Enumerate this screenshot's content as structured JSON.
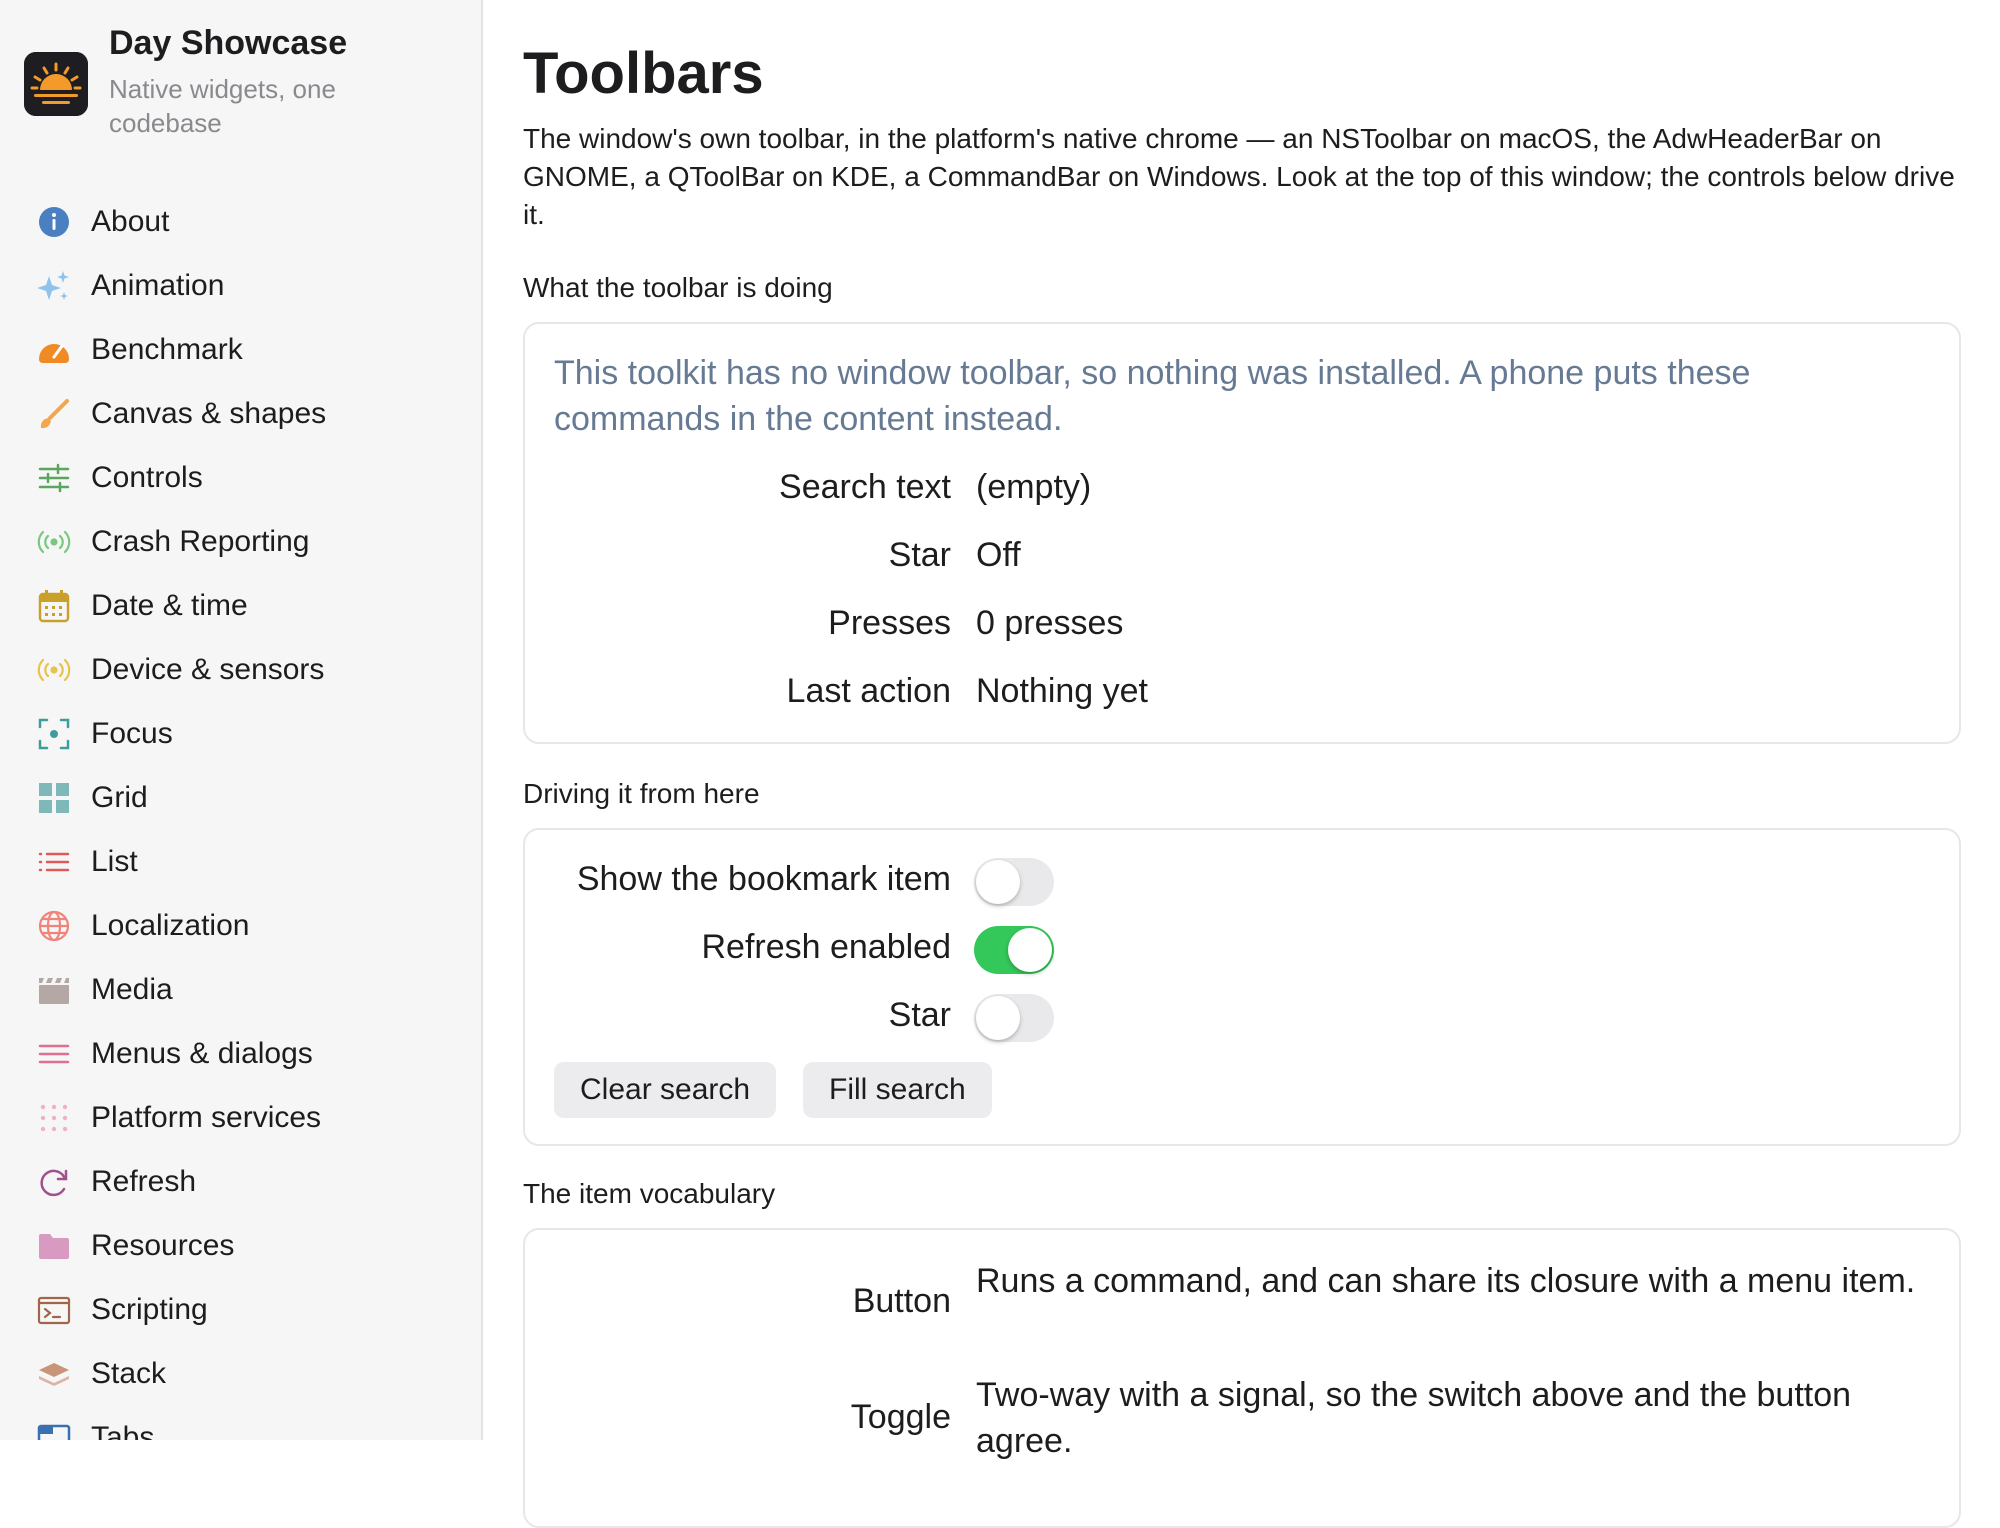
{
  "app": {
    "title": "Day Showcase",
    "subtitle": "Native widgets, one codebase"
  },
  "sidebar": {
    "items": [
      {
        "label": "About",
        "icon": "info-icon",
        "color": "#4a7fc1"
      },
      {
        "label": "Animation",
        "icon": "sparkles-icon",
        "color": "#8fc3ec"
      },
      {
        "label": "Benchmark",
        "icon": "speedometer-icon",
        "color": "#f08a24"
      },
      {
        "label": "Canvas & shapes",
        "icon": "brush-icon",
        "color": "#f4a64a"
      },
      {
        "label": "Controls",
        "icon": "sliders-icon",
        "color": "#5aa65f"
      },
      {
        "label": "Crash Reporting",
        "icon": "broadcast-icon",
        "color": "#7ac77f"
      },
      {
        "label": "Date & time",
        "icon": "calendar-icon",
        "color": "#c9a12a"
      },
      {
        "label": "Device & sensors",
        "icon": "sensor-icon",
        "color": "#e6c34a"
      },
      {
        "label": "Focus",
        "icon": "focus-icon",
        "color": "#3f9c9c"
      },
      {
        "label": "Grid",
        "icon": "grid-icon",
        "color": "#7fb8b8"
      },
      {
        "label": "List",
        "icon": "list-icon",
        "color": "#e05a5a"
      },
      {
        "label": "Localization",
        "icon": "globe-icon",
        "color": "#f0847a"
      },
      {
        "label": "Media",
        "icon": "clapper-icon",
        "color": "#b3a8a4"
      },
      {
        "label": "Menus & dialogs",
        "icon": "menu-icon",
        "color": "#e0708f"
      },
      {
        "label": "Platform services",
        "icon": "dots-icon",
        "color": "#f0b0c8"
      },
      {
        "label": "Refresh",
        "icon": "refresh-icon",
        "color": "#a0508c"
      },
      {
        "label": "Resources",
        "icon": "folder-icon",
        "color": "#d89ac0"
      },
      {
        "label": "Scripting",
        "icon": "terminal-icon",
        "color": "#a0664a"
      },
      {
        "label": "Stack",
        "icon": "stack-icon",
        "color": "#c8957a"
      },
      {
        "label": "Tabs",
        "icon": "tabs-icon",
        "color": "#3a6fb0"
      }
    ]
  },
  "main": {
    "title": "Toolbars",
    "intro": "The window's own toolbar, in the platform's native chrome — an NSToolbar on macOS, the AdwHeaderBar on GNOME, a QToolBar on KDE, a CommandBar on Windows. Look at the top of this window; the controls below drive it.",
    "status_section": {
      "label": "What the toolbar is doing",
      "note": "This toolkit has no window toolbar, so nothing was installed. A phone puts these commands in the content instead.",
      "rows": [
        {
          "key": "Search text",
          "value": "(empty)"
        },
        {
          "key": "Star",
          "value": "Off"
        },
        {
          "key": "Presses",
          "value": "0 presses"
        },
        {
          "key": "Last action",
          "value": "Nothing yet"
        }
      ]
    },
    "drive_section": {
      "label": "Driving it from here",
      "toggles": [
        {
          "label": "Show the bookmark item",
          "on": false
        },
        {
          "label": "Refresh enabled",
          "on": true
        },
        {
          "label": "Star",
          "on": false
        }
      ],
      "buttons": {
        "clear": "Clear search",
        "fill": "Fill search"
      }
    },
    "vocab_section": {
      "label": "The item vocabulary",
      "rows": [
        {
          "key": "Button",
          "value": "Runs a command, and can share its closure with a menu item."
        },
        {
          "key": "Toggle",
          "value": "Two-way with a signal, so the switch above and the button agree."
        }
      ]
    }
  },
  "colors": {
    "switch_on": "#34c759",
    "switch_off": "#e9e9eb",
    "note_text": "#677a94",
    "sidebar_bg": "#f6f6f7"
  }
}
